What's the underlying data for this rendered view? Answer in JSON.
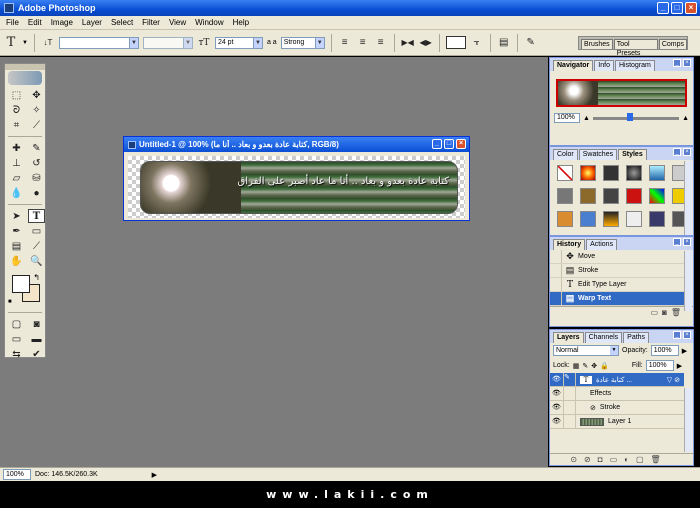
{
  "window": {
    "title": "Adobe Photoshop"
  },
  "menu": [
    "File",
    "Edit",
    "Image",
    "Layer",
    "Select",
    "Filter",
    "View",
    "Window",
    "Help"
  ],
  "options": {
    "font_size": "24 pt",
    "antialias_prefix": "a a",
    "antialias": "Strong"
  },
  "palette_well": {
    "tabs": [
      "Brushes",
      "Tool Presets",
      "Comps"
    ]
  },
  "document": {
    "title": "Untitled-1 @ 100% (كتابة عادة بعدو و بعاد .. أنا ما, RGB/8)",
    "banner_text": "كتابة عادة بعدو و بعاد .. أنا ما عاد أصبر على الفراق"
  },
  "status": {
    "zoom": "100%",
    "doc": "Doc: 146.5K/260.3K"
  },
  "watermark": "www.lakii.com",
  "navigator": {
    "tabs": [
      "Navigator",
      "Info",
      "Histogram"
    ],
    "zoom": "100%"
  },
  "styles_panel": {
    "tabs": [
      "Color",
      "Swatches",
      "Styles"
    ]
  },
  "history": {
    "tabs": [
      "History",
      "Actions"
    ],
    "items": [
      {
        "label": "Move",
        "icon": "move-icon"
      },
      {
        "label": "Stroke",
        "icon": "stroke-icon"
      },
      {
        "label": "Edit Type Layer",
        "icon": "type-icon"
      },
      {
        "label": "Warp Text",
        "icon": "warp-icon",
        "selected": true
      }
    ]
  },
  "layers": {
    "tabs": [
      "Layers",
      "Channels",
      "Paths"
    ],
    "blend_mode": "Normal",
    "opacity_label": "Opacity:",
    "opacity": "100%",
    "lock_label": "Lock:",
    "fill_label": "Fill:",
    "fill": "100%",
    "items": [
      {
        "label": "كتابة عادة ...",
        "type": "text",
        "selected": true
      },
      {
        "label": "Effects",
        "type": "effects"
      },
      {
        "label": "Stroke",
        "type": "effect"
      },
      {
        "label": "Layer 1",
        "type": "pixel"
      }
    ]
  }
}
